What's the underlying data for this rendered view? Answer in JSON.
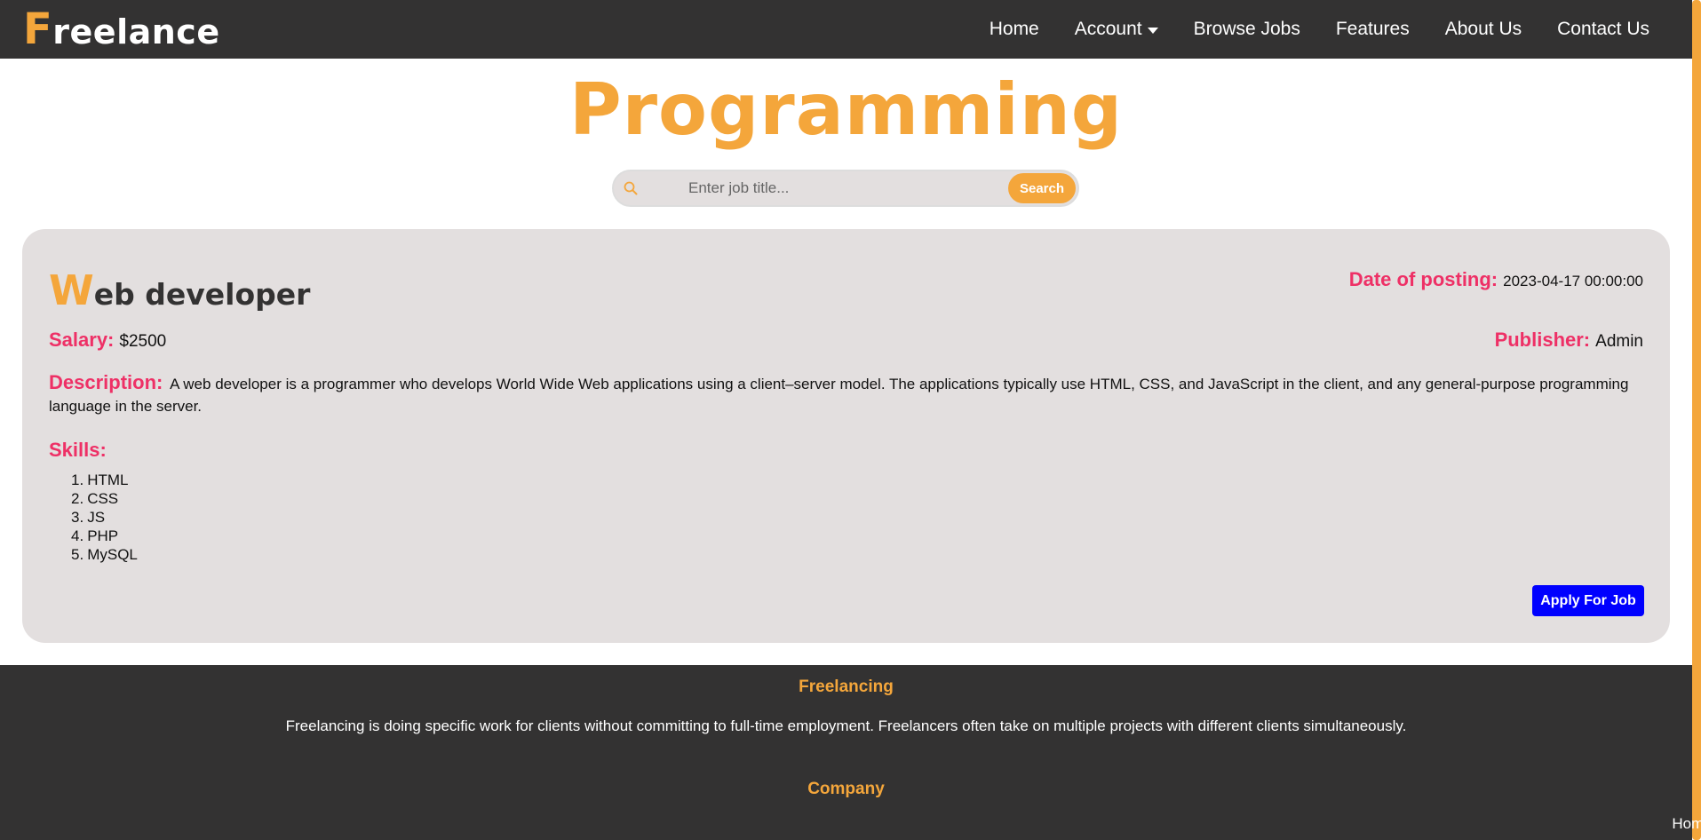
{
  "header": {
    "logo_first": "F",
    "logo_rest": "reelance",
    "nav": [
      {
        "label": "Home"
      },
      {
        "label": "Account"
      },
      {
        "label": "Browse Jobs"
      },
      {
        "label": "Features"
      },
      {
        "label": "About Us"
      },
      {
        "label": "Contact Us"
      }
    ]
  },
  "page": {
    "title": "Programming"
  },
  "search": {
    "placeholder": "Enter job title...",
    "button_label": "Search"
  },
  "job": {
    "title_first": "W",
    "title_rest": "eb developer",
    "date_label": "Date of posting:",
    "date_value": "2023-04-17 00:00:00",
    "salary_label": "Salary:",
    "salary_value": "$2500",
    "publisher_label": "Publisher:",
    "publisher_value": "Admin",
    "description_label": "Description:",
    "description_text": "A web developer is a programmer who develops World Wide Web applications using a client–server model. The applications typically use HTML, CSS, and JavaScript in the client, and any general-purpose programming language in the server.",
    "skills_label": "Skills:",
    "skills": [
      {
        "num": "1.",
        "name": "HTML"
      },
      {
        "num": "2.",
        "name": "CSS"
      },
      {
        "num": "3.",
        "name": "JS"
      },
      {
        "num": "4.",
        "name": "PHP"
      },
      {
        "num": "5.",
        "name": "MySQL"
      }
    ],
    "apply_label": "Apply For Job"
  },
  "footer": {
    "heading1": "Freelancing",
    "text": "Freelancing is doing specific work for clients without committing to full-time employment. Freelancers often take on multiple projects with different clients simultaneously.",
    "heading2": "Company",
    "link1": "Home"
  },
  "colors": {
    "accent": "#f4a63b",
    "label": "#ee3066",
    "dark": "#333232",
    "card": "#e3dfdf",
    "apply": "#0000ff"
  }
}
